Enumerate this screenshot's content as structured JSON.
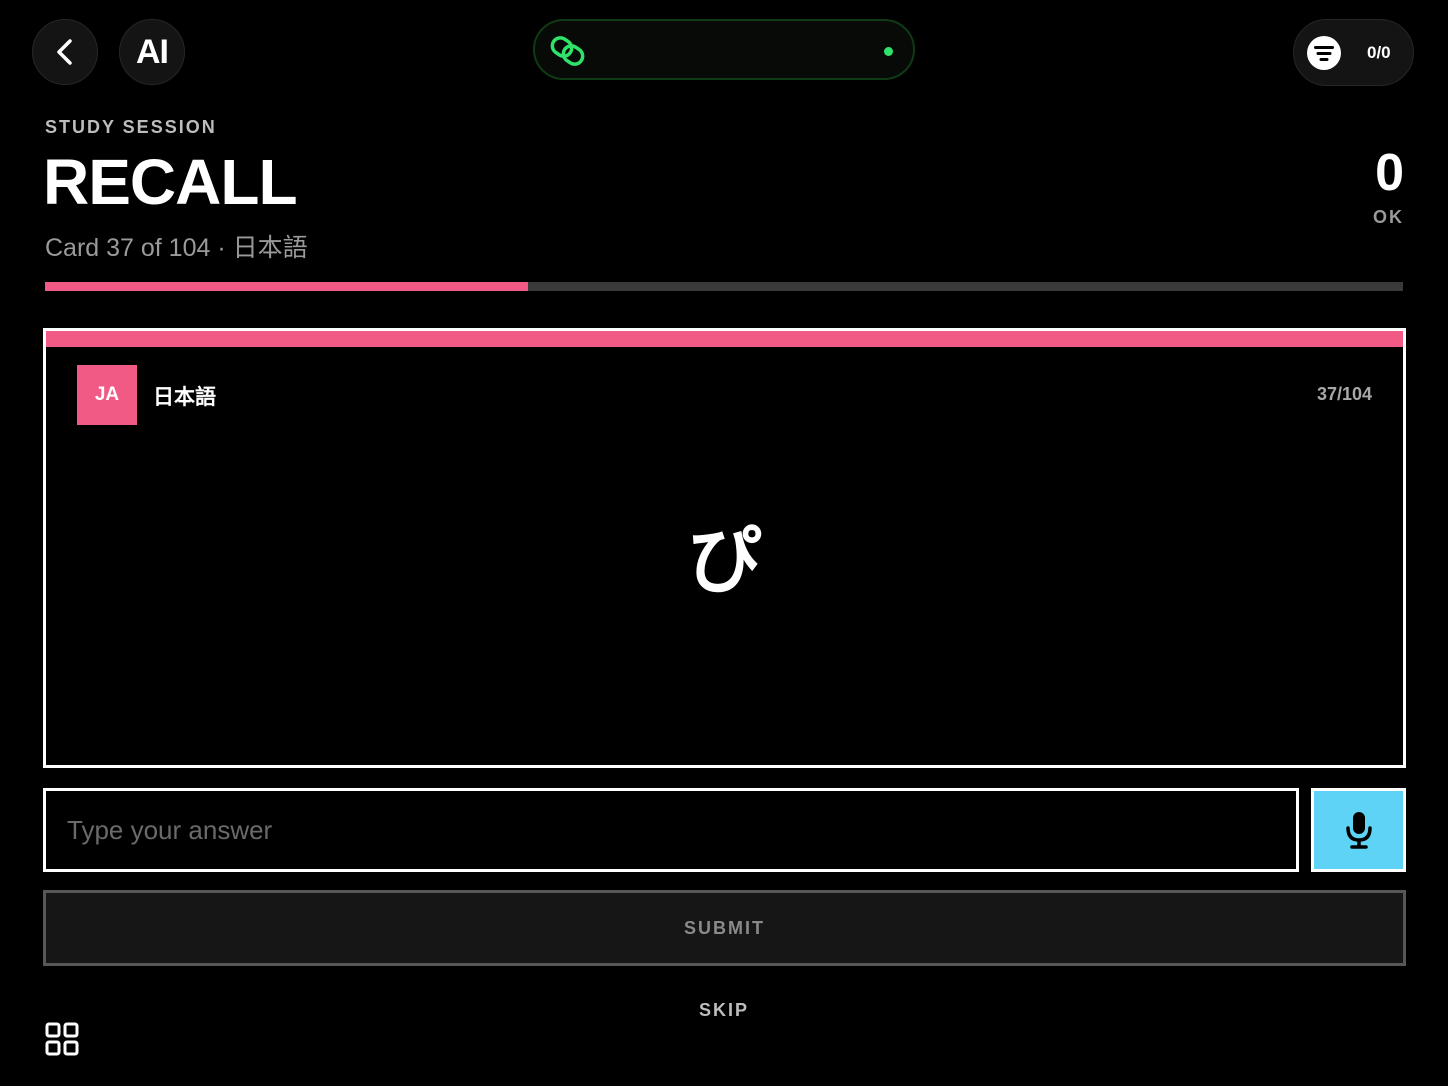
{
  "header": {
    "back_icon": "chevron-left-icon",
    "text_tool_label": "AI",
    "sync": {
      "icon": "link-icon",
      "status": "connected",
      "status_color": "#2fe36a"
    },
    "filter": {
      "icon": "filter-icon",
      "count": "0/0"
    }
  },
  "session": {
    "eyebrow": "STUDY SESSION",
    "title": "RECALL",
    "subtitle": "Card 37 of 104 · 日本語",
    "score": "0",
    "score_label": "OK",
    "progress": 0.356
  },
  "card": {
    "lang_code": "JA",
    "lang_name": "日本語",
    "counter": "37/104",
    "prompt": "ぴ",
    "accent_color": "#f25a86"
  },
  "answer": {
    "placeholder": "Type your answer",
    "value": ""
  },
  "actions": {
    "mic_icon": "microphone-icon",
    "mic_color": "#5fd3f5",
    "submit_label": "SUBMIT",
    "skip_label": "SKIP",
    "grid_icon": "grid-icon"
  }
}
